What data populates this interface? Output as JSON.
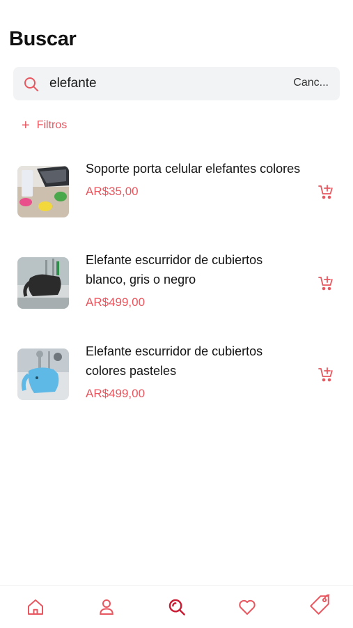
{
  "header": {
    "title": "Buscar"
  },
  "search": {
    "value": "elefante",
    "cancel_label": "Canc..."
  },
  "filters": {
    "label": "Filtros"
  },
  "colors": {
    "accent": "#e8575f",
    "accent_dark": "#c81d35"
  },
  "results": [
    {
      "name": "Soporte porta celular elefantes colores",
      "price": "AR$35,00"
    },
    {
      "name": "Elefante escurridor de cubiertos blanco, gris o negro",
      "price": "AR$499,00"
    },
    {
      "name": "Elefante escurridor de cubiertos colores pasteles",
      "price": "AR$499,00"
    }
  ],
  "bottom_nav": [
    {
      "icon": "home-icon",
      "active": false
    },
    {
      "icon": "profile-icon",
      "active": false
    },
    {
      "icon": "search-icon",
      "active": true
    },
    {
      "icon": "heart-icon",
      "active": false
    },
    {
      "icon": "tag-icon",
      "active": false
    }
  ]
}
